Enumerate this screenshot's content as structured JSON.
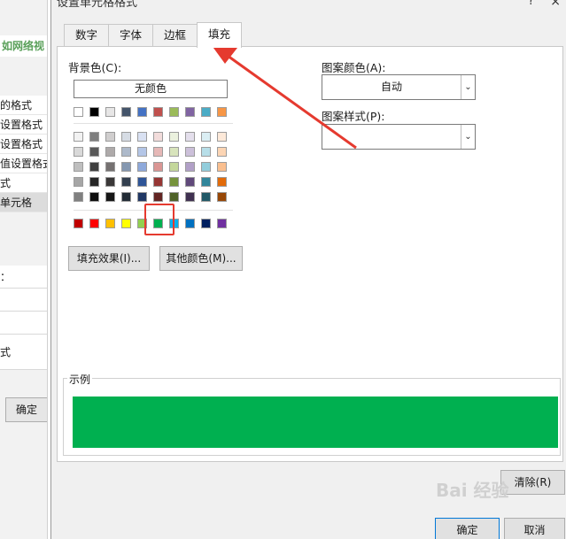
{
  "background_window": {
    "title_fragment": "如网络视",
    "list_items": [
      "的格式",
      "设置格式",
      "设置格式",
      "值设置格式",
      "式",
      "单元格"
    ],
    "fields": [
      "：",
      "",
      "",
      "式",
      ""
    ],
    "ok_button": "确定"
  },
  "dialog": {
    "title": "设置单元格格式",
    "help_icon": "?",
    "close_icon": "×",
    "tabs": [
      {
        "label": "数字"
      },
      {
        "label": "字体"
      },
      {
        "label": "边框"
      },
      {
        "label": "填充"
      }
    ],
    "fill": {
      "background_color_label": "背景色(C):",
      "no_color_button": "无颜色",
      "palette_standard_row": [
        "#ffffff",
        "#000000",
        "#e7e6e6",
        "#44546a",
        "#4472c4",
        "#c0504d",
        "#9bbb59",
        "#8064a2",
        "#4bacc6",
        "#f79646"
      ],
      "palette_tints": [
        [
          "#f2f2f2",
          "#7f7f7f",
          "#d0cece",
          "#d6dce4",
          "#d9e1f2",
          "#f2dcdb",
          "#ebf1de",
          "#e4dfec",
          "#dbeef3",
          "#fde9d9"
        ],
        [
          "#d9d9d9",
          "#595959",
          "#aeaaaa",
          "#adb9ca",
          "#b4c6e7",
          "#e6b8b7",
          "#d8e4bc",
          "#ccc0da",
          "#b7dee8",
          "#fcd5b4"
        ],
        [
          "#bfbfbf",
          "#404040",
          "#757171",
          "#8497b0",
          "#8ea9db",
          "#da9694",
          "#c4d79b",
          "#b1a0c7",
          "#92cddc",
          "#fabf8f"
        ],
        [
          "#a6a6a6",
          "#262626",
          "#3a3838",
          "#333f4f",
          "#2f5597",
          "#963634",
          "#76933c",
          "#60497a",
          "#31869b",
          "#e26b0a"
        ],
        [
          "#808080",
          "#0d0d0d",
          "#161616",
          "#222b35",
          "#203764",
          "#632523",
          "#4f6228",
          "#403151",
          "#215967",
          "#974706"
        ]
      ],
      "palette_standard_colors": [
        "#c00000",
        "#ff0000",
        "#ffc000",
        "#ffff00",
        "#92d050",
        "#00b050",
        "#00b0f0",
        "#0070c0",
        "#002060",
        "#7030a0"
      ],
      "selected_color": "#00b050",
      "fill_effects_button": "填充效果(I)...",
      "more_colors_button": "其他颜色(M)...",
      "pattern_color_label": "图案颜色(A):",
      "pattern_color_value": "自动",
      "pattern_style_label": "图案样式(P):",
      "pattern_style_value": "",
      "sample_label": "示例"
    },
    "clear_button": "清除(R)",
    "ok_button": "确定",
    "cancel_button": "取消"
  },
  "annotation_color": "#e53a2f",
  "watermark": "Bai 经验"
}
